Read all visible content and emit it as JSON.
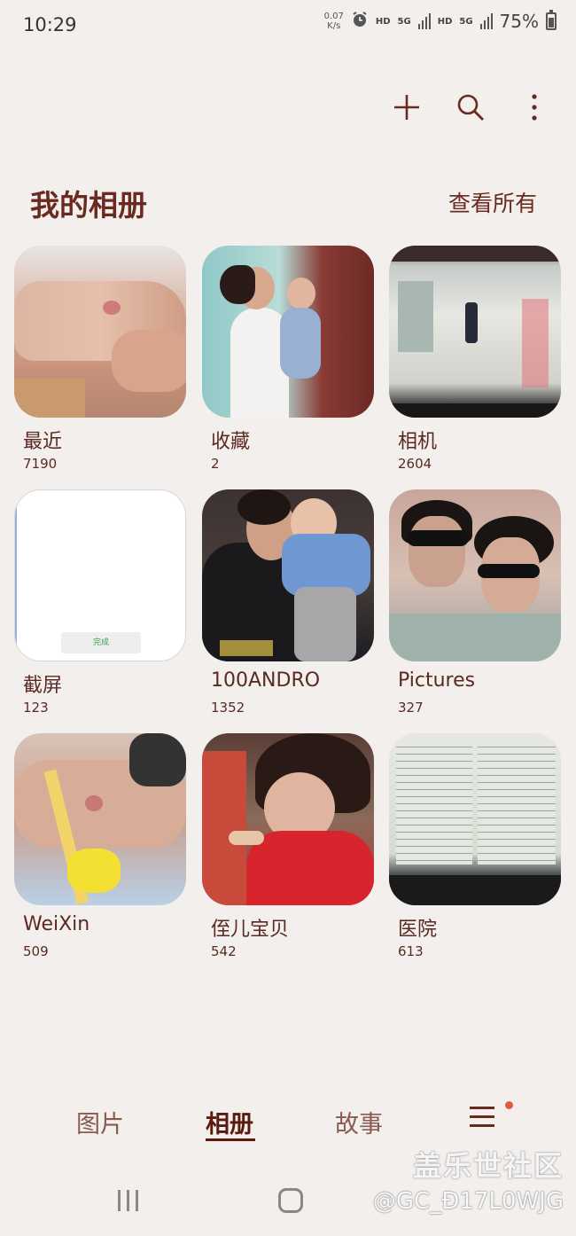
{
  "status_bar": {
    "time": "10:29",
    "speed_value": "0.07",
    "speed_unit": "K/s",
    "hd1": "HD",
    "net1": "5G",
    "hd2": "HD",
    "net2": "5G",
    "battery": "75%"
  },
  "toolbar": {
    "add_icon": "plus-icon",
    "search_icon": "search-icon",
    "more_icon": "more-vert-icon"
  },
  "section": {
    "title": "我的相册",
    "view_all": "查看所有"
  },
  "albums": [
    {
      "name": "最近",
      "count": "7190"
    },
    {
      "name": "收藏",
      "count": "2"
    },
    {
      "name": "相机",
      "count": "2604"
    },
    {
      "name": "截屏",
      "count": "123",
      "thumb_button": "完成"
    },
    {
      "name": "100ANDRO",
      "count": "1352"
    },
    {
      "name": "Pictures",
      "count": "327"
    },
    {
      "name": "WeiXin",
      "count": "509"
    },
    {
      "name": "侄儿宝贝",
      "count": "542"
    },
    {
      "name": "医院",
      "count": "613"
    }
  ],
  "bottom_nav": {
    "tabs": [
      {
        "label": "图片"
      },
      {
        "label": "相册",
        "active": true
      },
      {
        "label": "故事"
      }
    ]
  },
  "watermark": {
    "line1": "盖乐世社区",
    "line2": "@GC_Đ17L0WJG"
  },
  "colors": {
    "background": "#f2efed",
    "accent": "#6a2a20",
    "notification_dot": "#e05a3a"
  }
}
